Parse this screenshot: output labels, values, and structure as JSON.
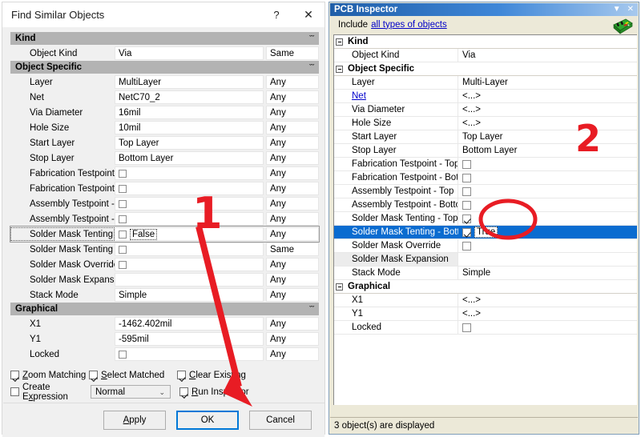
{
  "find_similar": {
    "title": "Find Similar Objects",
    "help_label": "?",
    "close_label": "✕",
    "chevron": "ˇˇ",
    "sections": [
      {
        "name": "Kind",
        "rows": [
          {
            "label": "Object Kind",
            "value": "Via",
            "mode": "Same",
            "checkbox": false
          }
        ]
      },
      {
        "name": "Object Specific",
        "rows": [
          {
            "label": "Layer",
            "value": "MultiLayer",
            "mode": "Any",
            "checkbox": false
          },
          {
            "label": "Net",
            "value": "NetC70_2",
            "mode": "Any",
            "checkbox": false
          },
          {
            "label": "Via Diameter",
            "value": "16mil",
            "mode": "Any",
            "checkbox": false
          },
          {
            "label": "Hole Size",
            "value": "10mil",
            "mode": "Any",
            "checkbox": false
          },
          {
            "label": "Start Layer",
            "value": "Top Layer",
            "mode": "Any",
            "checkbox": false
          },
          {
            "label": "Stop Layer",
            "value": "Bottom Layer",
            "mode": "Any",
            "checkbox": false
          },
          {
            "label": "Fabrication Testpoint - T",
            "value": "",
            "mode": "Any",
            "checkbox": true,
            "checked": false
          },
          {
            "label": "Fabrication Testpoint - B",
            "value": "",
            "mode": "Any",
            "checkbox": true,
            "checked": false
          },
          {
            "label": "Assembly Testpoint - Top",
            "value": "",
            "mode": "Any",
            "checkbox": true,
            "checked": false
          },
          {
            "label": "Assembly Testpoint - Bot",
            "value": "",
            "mode": "Any",
            "checkbox": true,
            "checked": false
          },
          {
            "label": "Solder Mask Tenting - T",
            "value": "False",
            "mode": "Any",
            "checkbox": true,
            "checked": false,
            "focused": true
          },
          {
            "label": "Solder Mask Tenting - B",
            "value": "",
            "mode": "Same",
            "checkbox": true,
            "checked": false
          },
          {
            "label": "Solder Mask Override",
            "value": "",
            "mode": "Any",
            "checkbox": true,
            "checked": false
          },
          {
            "label": "Solder Mask Expansion",
            "value": "",
            "mode": "Any",
            "checkbox": false
          },
          {
            "label": "Stack Mode",
            "value": "Simple",
            "mode": "Any",
            "checkbox": false
          }
        ]
      },
      {
        "name": "Graphical",
        "rows": [
          {
            "label": "X1",
            "value": "-1462.402mil",
            "mode": "Any",
            "checkbox": false
          },
          {
            "label": "Y1",
            "value": "-595mil",
            "mode": "Any",
            "checkbox": false
          },
          {
            "label": "Locked",
            "value": "",
            "mode": "Any",
            "checkbox": true,
            "checked": false
          }
        ]
      }
    ],
    "options": {
      "zoom_matching": {
        "label": "Zoom Matching",
        "checked": true
      },
      "select_matched": {
        "label": "Select Matched",
        "checked": true
      },
      "clear_existing": {
        "label": "Clear Existing",
        "checked": true
      },
      "create_expression": {
        "label": "Create Expression",
        "checked": false
      },
      "run_inspector": {
        "label": "Run Inspector",
        "checked": true
      },
      "mode_select": {
        "value": "Normal",
        "arrow": "⌄"
      }
    },
    "buttons": {
      "apply": "Apply",
      "ok": "OK",
      "cancel": "Cancel"
    }
  },
  "pcb_inspector": {
    "title": "PCB Inspector",
    "titlebar_menu": "▼",
    "titlebar_close": "✕",
    "include_label": "Include",
    "include_link": "all types of objects",
    "sections": [
      {
        "name": "Kind",
        "rows": [
          {
            "label": "Object Kind",
            "value": "Via",
            "type": "text"
          }
        ]
      },
      {
        "name": "Object Specific",
        "rows": [
          {
            "label": "Layer",
            "value": "Multi-Layer",
            "type": "text"
          },
          {
            "label": "Net",
            "value": "<...>",
            "type": "text",
            "link": true
          },
          {
            "label": "Via Diameter",
            "value": "<...>",
            "type": "text"
          },
          {
            "label": "Hole Size",
            "value": "<...>",
            "type": "text"
          },
          {
            "label": "Start Layer",
            "value": "Top Layer",
            "type": "text"
          },
          {
            "label": "Stop Layer",
            "value": "Bottom Layer",
            "type": "text"
          },
          {
            "label": "Fabrication Testpoint - Top",
            "value": "",
            "type": "check",
            "checked": false
          },
          {
            "label": "Fabrication Testpoint - Bottom",
            "value": "",
            "type": "check",
            "checked": false
          },
          {
            "label": "Assembly Testpoint - Top",
            "value": "",
            "type": "check",
            "checked": false
          },
          {
            "label": "Assembly Testpoint - Bottom",
            "value": "",
            "type": "check",
            "checked": false
          },
          {
            "label": "Solder Mask Tenting - Top",
            "value": "",
            "type": "check",
            "checked": true
          },
          {
            "label": "Solder Mask Tenting - Bottom",
            "value": "True",
            "type": "check",
            "checked": true,
            "selected": true
          },
          {
            "label": "Solder Mask Override",
            "value": "",
            "type": "check",
            "checked": false
          },
          {
            "label": "Solder Mask Expansion",
            "value": "",
            "type": "text",
            "shaded": true
          },
          {
            "label": "Stack Mode",
            "value": "Simple",
            "type": "text"
          }
        ]
      },
      {
        "name": "Graphical",
        "rows": [
          {
            "label": "X1",
            "value": "<...>",
            "type": "text"
          },
          {
            "label": "Y1",
            "value": "<...>",
            "type": "text"
          },
          {
            "label": "Locked",
            "value": "",
            "type": "check",
            "checked": false
          }
        ]
      }
    ],
    "status": "3 object(s) are displayed"
  },
  "annotations": {
    "step1": "1",
    "step2": "2",
    "accent": "#e81c24"
  }
}
